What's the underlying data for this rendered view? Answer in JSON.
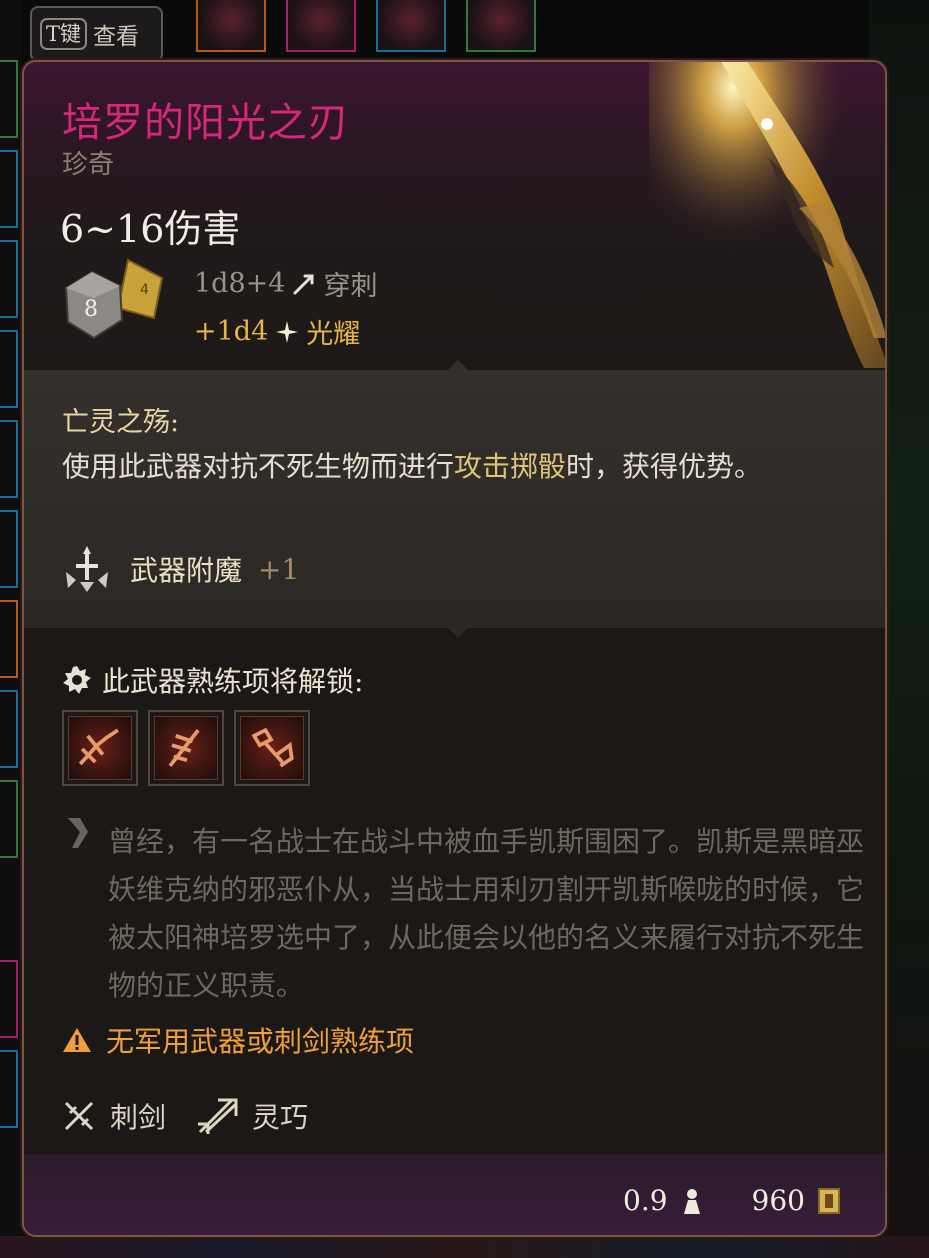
{
  "hotkey": {
    "key": "T键",
    "label": "查看"
  },
  "item": {
    "name": "培罗的阳光之刃",
    "rarity": "珍奇",
    "damage_range": "6~16伤害",
    "damage_lines": [
      {
        "dice": "1d8+4",
        "type": "穿刺",
        "icon": "piercing-arrow-icon"
      },
      {
        "dice": "+1d4",
        "type": "光耀",
        "icon": "radiant-sparkle-icon"
      }
    ],
    "die_face": "8",
    "colors": {
      "name": "#d6287a",
      "radiant": "#e8b54a",
      "warning": "#ef9f3c"
    }
  },
  "passive": {
    "name": "亡灵之殇:",
    "desc_before": "使用此武器对抗不死生物而进行",
    "desc_highlight": "攻击掷骰",
    "desc_after": "时，获得优势。"
  },
  "enchant": {
    "label": "武器附魔",
    "value": "+1"
  },
  "proficiency": {
    "label": "此武器熟练项将解锁:",
    "skills": [
      "skill-icon-1",
      "skill-icon-2",
      "skill-icon-3"
    ]
  },
  "lore": "曾经，有一名战士在战斗中被血手凯斯围困了。凯斯是黑暗巫妖维克纳的邪恶仆从，当战士用利刃割开凯斯喉咙的时候，它被太阳神培罗选中了，从此便会以他的名义来履行对抗不死生物的正义职责。",
  "warning": "无军用武器或刺剑熟练项",
  "properties": [
    {
      "label": "刺剑",
      "icon": "rapier-icon"
    },
    {
      "label": "灵巧",
      "icon": "finesse-icon"
    }
  ],
  "footer": {
    "weight": "0.9",
    "value": "960"
  }
}
